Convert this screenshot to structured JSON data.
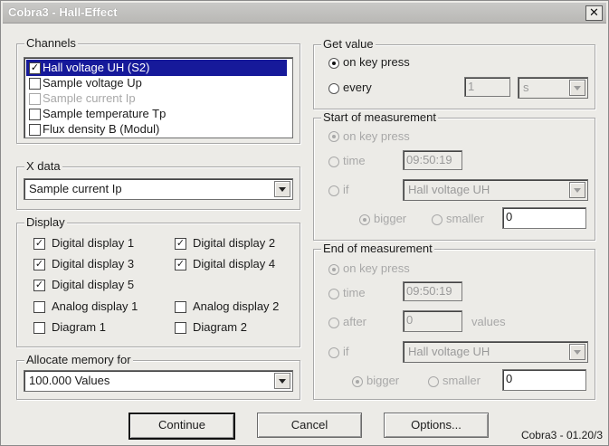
{
  "window": {
    "title": "Cobra3 - Hall-Effect",
    "close_symbol": "✕"
  },
  "channels": {
    "legend": "Channels",
    "items": [
      {
        "label": "Hall voltage UH    (S2)",
        "checked": true,
        "selected": true,
        "disabled": false
      },
      {
        "label": "Sample voltage Up",
        "checked": false,
        "selected": false,
        "disabled": false
      },
      {
        "label": "Sample current Ip",
        "checked": false,
        "selected": false,
        "disabled": true
      },
      {
        "label": "Sample temperature Tp",
        "checked": false,
        "selected": false,
        "disabled": false
      },
      {
        "label": "Flux density B    (Modul)",
        "checked": false,
        "selected": false,
        "disabled": false
      }
    ]
  },
  "xdata": {
    "legend": "X data",
    "value": "Sample current Ip"
  },
  "display": {
    "legend": "Display",
    "left": [
      {
        "label": "Digital display 1",
        "checked": true
      },
      {
        "label": "Digital display 3",
        "checked": true
      },
      {
        "label": "Digital display 5",
        "checked": true
      },
      {
        "label": "Analog display 1",
        "checked": false
      },
      {
        "label": "Diagram 1",
        "checked": false
      }
    ],
    "right": [
      {
        "label": "Digital display 2",
        "checked": true
      },
      {
        "label": "Digital display 4",
        "checked": true
      },
      {
        "label": "Analog display 2",
        "checked": false
      },
      {
        "label": "Diagram 2",
        "checked": false
      }
    ]
  },
  "memory": {
    "legend": "Allocate memory for",
    "value": "100.000 Values"
  },
  "getvalue": {
    "legend": "Get value",
    "on_key_press": "on key press",
    "every": "every",
    "every_value": "1",
    "every_unit": "s"
  },
  "start": {
    "legend": "Start of measurement",
    "on_key_press": "on key press",
    "time": "time",
    "time_value": "09:50:19",
    "if": "if",
    "if_channel": "Hall voltage UH",
    "bigger": "bigger",
    "smaller": "smaller",
    "threshold": "0"
  },
  "end": {
    "legend": "End of measurement",
    "on_key_press": "on key press",
    "time": "time",
    "time_value": "09:50:19",
    "after": "after",
    "after_value": "0",
    "values_label": "values",
    "if": "if",
    "if_channel": "Hall voltage UH",
    "bigger": "bigger",
    "smaller": "smaller",
    "threshold": "0"
  },
  "buttons": {
    "continue": "Continue",
    "cancel": "Cancel",
    "options": "Options..."
  },
  "footer": "Cobra3 - 01.20/3",
  "check_mark": "✓"
}
